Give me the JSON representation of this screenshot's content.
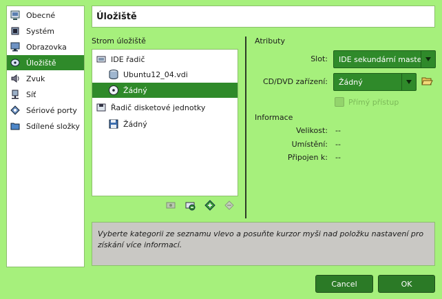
{
  "nav": {
    "items": [
      {
        "label": "Obecné",
        "icon": "general-icon"
      },
      {
        "label": "Systém",
        "icon": "system-icon"
      },
      {
        "label": "Obrazovka",
        "icon": "display-icon"
      },
      {
        "label": "Úložiště",
        "icon": "storage-icon",
        "selected": true
      },
      {
        "label": "Zvuk",
        "icon": "audio-icon"
      },
      {
        "label": "Síť",
        "icon": "network-icon"
      },
      {
        "label": "Sériové porty",
        "icon": "serial-ports-icon"
      },
      {
        "label": "Sdílené složky",
        "icon": "shared-folders-icon"
      }
    ]
  },
  "page": {
    "title": "Úložiště"
  },
  "tree": {
    "label": "Strom úložiště",
    "rows": [
      {
        "label": "IDE řadič",
        "icon": "ide-controller-icon"
      },
      {
        "label": "Ubuntu12_04.vdi",
        "icon": "hard-disk-icon"
      },
      {
        "label": "Žádný",
        "icon": "cd-dvd-icon",
        "selected": true
      },
      {
        "label": "Řadič disketové jednotky",
        "icon": "floppy-controller-icon"
      },
      {
        "label": "Žádný",
        "icon": "floppy-disk-icon"
      }
    ],
    "toolbar": [
      "add-controller-icon",
      "remove-controller-icon",
      "add-attachment-icon",
      "remove-attachment-icon"
    ]
  },
  "attributes": {
    "heading": "Atributy",
    "slot_label": "Slot:",
    "slot_value": "IDE sekundární master",
    "cd_label": "CD/DVD zařízení:",
    "cd_value": "Žádný",
    "live_cd_label": "Přímý přístup"
  },
  "info": {
    "heading": "Informace",
    "size_label": "Velikost:",
    "size_value": "--",
    "location_label": "Umístění:",
    "location_value": "--",
    "attached_label": "Připojen k:",
    "attached_value": "--"
  },
  "hint": {
    "text": "Vyberte kategorii ze seznamu vlevo a posuňte kurzor myši nad položku nastavení pro získání více informací."
  },
  "buttons": {
    "cancel": "Cancel",
    "ok": "OK"
  },
  "colors": {
    "background": "#a6f07c",
    "accent": "#2f8a2a"
  }
}
